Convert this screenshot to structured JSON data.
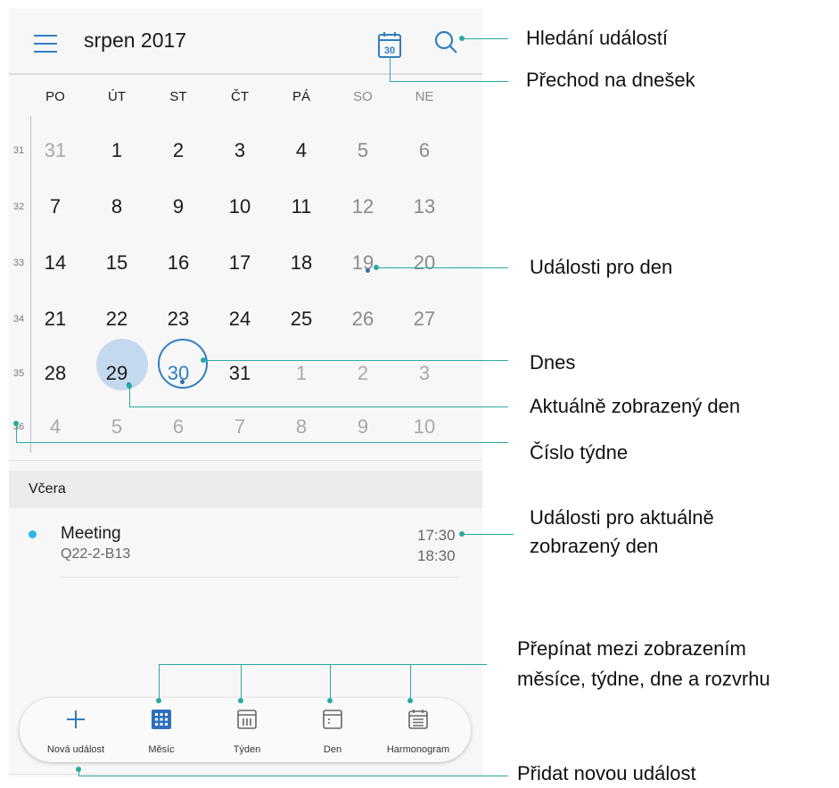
{
  "header": {
    "title": "srpen 2017",
    "today_icon_day": "30"
  },
  "weekdays": [
    "PO",
    "ÚT",
    "ST",
    "ČT",
    "PÁ",
    "SO",
    "NE"
  ],
  "weeks": [
    {
      "number": "31",
      "days": [
        "31",
        "1",
        "2",
        "3",
        "4",
        "5",
        "6"
      ]
    },
    {
      "number": "32",
      "days": [
        "7",
        "8",
        "9",
        "10",
        "11",
        "12",
        "13"
      ]
    },
    {
      "number": "33",
      "days": [
        "14",
        "15",
        "16",
        "17",
        "18",
        "19",
        "20"
      ]
    },
    {
      "number": "34",
      "days": [
        "21",
        "22",
        "23",
        "24",
        "25",
        "26",
        "27"
      ]
    },
    {
      "number": "35",
      "days": [
        "28",
        "29",
        "30",
        "31",
        "1",
        "2",
        "3"
      ]
    },
    {
      "number": "36",
      "days": [
        "4",
        "5",
        "6",
        "7",
        "8",
        "9",
        "10"
      ]
    }
  ],
  "agenda": {
    "section_label": "Včera",
    "events": [
      {
        "title": "Meeting",
        "location": "Q22-2-B13",
        "start": "17:30",
        "end": "18:30"
      }
    ]
  },
  "bottom_nav": [
    {
      "label": "Nová událost",
      "icon": "plus-icon"
    },
    {
      "label": "Měsíc",
      "icon": "month-grid-icon"
    },
    {
      "label": "Týden",
      "icon": "week-icon"
    },
    {
      "label": "Den",
      "icon": "day-icon"
    },
    {
      "label": "Harmonogram",
      "icon": "schedule-icon"
    }
  ],
  "annotations": {
    "search": "Hledání událostí",
    "go_today": "Přechod na dnešek",
    "day_events": "Události pro den",
    "today": "Dnes",
    "current_day": "Aktuálně zobrazený den",
    "week_number": "Číslo týdne",
    "shown_day_events_1": "Události pro aktuálně",
    "shown_day_events_2": "zobrazený den",
    "switch_views_1": "Přepínat mezi zobrazením",
    "switch_views_2": "měsíce, týdne, dne a rozvrhu",
    "new_event": "Přidat novou událost"
  },
  "colors": {
    "accent": "#2f7fc0",
    "callout": "#2aa9a0",
    "selected_bg": "#c4d9ee",
    "event_dot": "#2db7e8"
  }
}
